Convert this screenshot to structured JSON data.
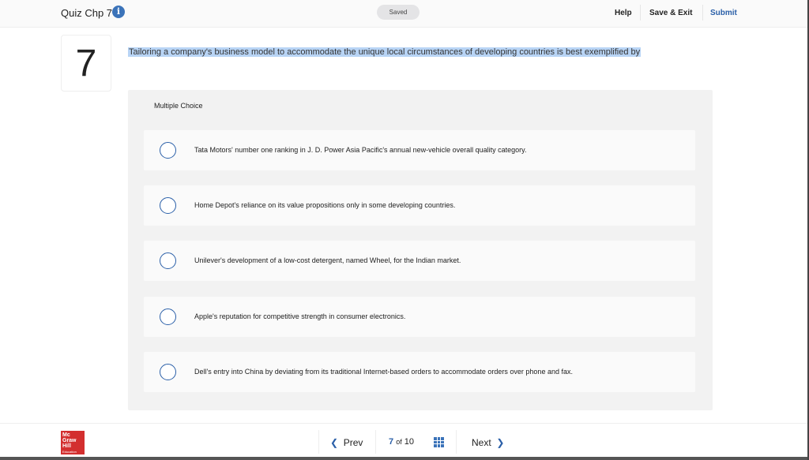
{
  "header": {
    "title": "Quiz Chp 7",
    "saved": "Saved",
    "help": "Help",
    "save_exit": "Save & Exit",
    "submit": "Submit"
  },
  "question": {
    "number": "7",
    "text": "Tailoring a company's business model to accommodate the unique local circumstances of developing countries is best exemplified by",
    "type": "Multiple Choice",
    "options": [
      "Tata Motors' number one ranking in J. D. Power Asia Pacific's annual new-vehicle overall quality category.",
      "Home Depot's reliance on its value propositions only in some developing countries.",
      "Unilever's development of a low-cost detergent, named Wheel, for the Indian market.",
      "Apple's reputation for competitive strength in consumer electronics.",
      "Dell's entry into China by deviating from its traditional Internet-based orders to accommodate orders over phone and fax."
    ]
  },
  "footer": {
    "logo": "Mc Graw Hill Education",
    "prev": "Prev",
    "current": "7",
    "of": "of",
    "total": "10",
    "next": "Next"
  },
  "colors": {
    "accent": "#2a5fa8",
    "logo": "#d32f2f",
    "highlight": "#b8d4f5"
  }
}
